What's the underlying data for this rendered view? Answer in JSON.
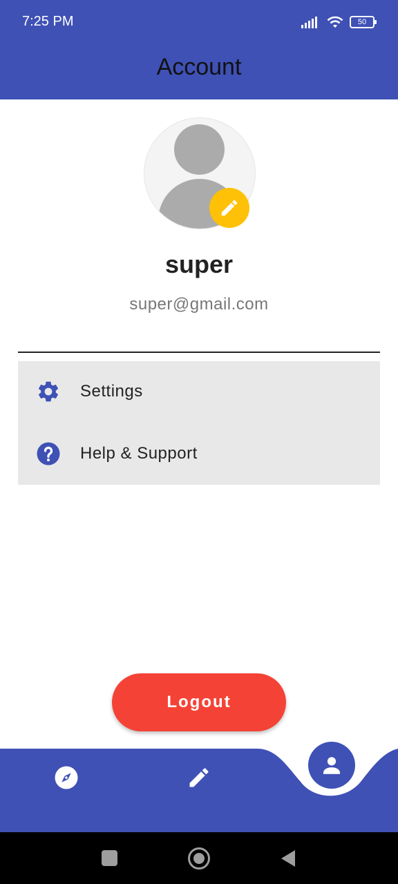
{
  "status_bar": {
    "time": "7:25 PM",
    "battery": "50",
    "icons": [
      "signal-icon",
      "wifi-icon",
      "battery-icon"
    ]
  },
  "app_bar": {
    "title": "Account"
  },
  "profile": {
    "name": "super",
    "email": "super@gmail.com",
    "edit_icon": "pencil-icon"
  },
  "menu": {
    "items": [
      {
        "label": "Settings",
        "icon": "gear-icon"
      },
      {
        "label": "Help & Support",
        "icon": "help-circle-icon"
      }
    ]
  },
  "logout": {
    "label": "Logout"
  },
  "bottom_nav": {
    "items": [
      {
        "icon": "compass-icon",
        "active": false
      },
      {
        "icon": "pencil-icon",
        "active": false
      },
      {
        "icon": "person-icon",
        "active": true
      }
    ]
  },
  "colors": {
    "primary": "#3f51b5",
    "accent": "#ffc107",
    "logout": "#f44336",
    "menu_background": "#e8e8e8"
  }
}
